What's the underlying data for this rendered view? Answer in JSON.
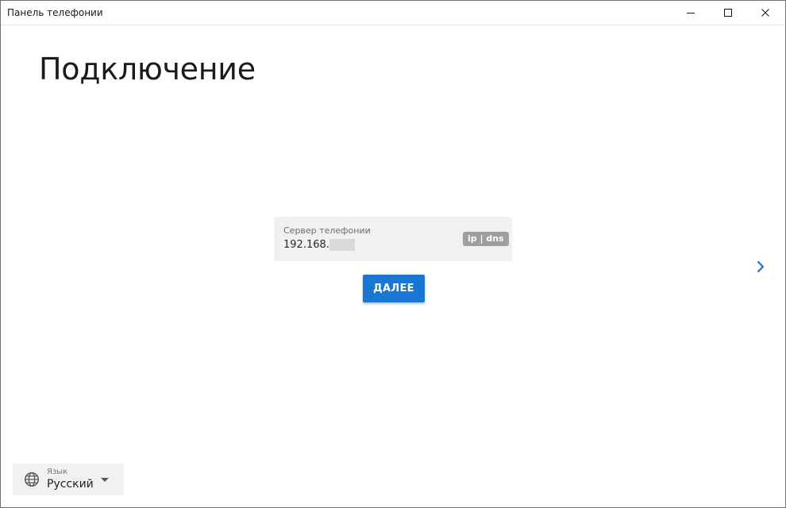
{
  "window": {
    "title": "Панель телефонии"
  },
  "page": {
    "title": "Подключение"
  },
  "server_field": {
    "label": "Сервер телефонии",
    "value": "192.168.",
    "hint": "ip | dns"
  },
  "actions": {
    "next_label": "ДАЛЕЕ"
  },
  "language": {
    "label": "Язык",
    "value": "Русский"
  },
  "icons": {
    "minimize": "minimize-icon",
    "maximize": "maximize-icon",
    "close": "close-icon",
    "next": "chevron-right-icon",
    "globe": "globe-icon",
    "caret": "caret-down-icon"
  },
  "colors": {
    "accent": "#1976d2",
    "field_bg": "#f1f1f1",
    "badge_bg": "#9e9e9e"
  }
}
